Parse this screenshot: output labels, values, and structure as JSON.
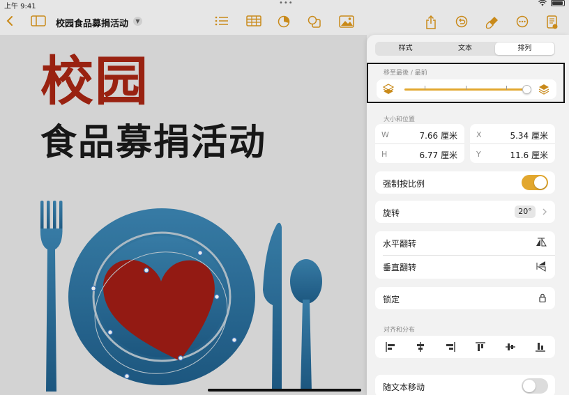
{
  "status": {
    "time": "上午 9:41",
    "center_dots": "•••"
  },
  "toolbar": {
    "title": "校园食品募捐活动",
    "icons": [
      "back-chevron-icon",
      "sidebar-icon",
      "list-icon",
      "table-icon",
      "chart-icon",
      "shape-icon",
      "media-icon",
      "share-icon",
      "undo-icon",
      "format-brush-icon",
      "more-icon",
      "document-icon"
    ],
    "accent": "#c98a1a"
  },
  "canvas": {
    "headline1": "校园",
    "headline2": "食品募捐活动",
    "colors": {
      "headline1": "#a62513",
      "plate": "#2f79a8",
      "heart": "#a01d15"
    }
  },
  "panel": {
    "tabs": [
      {
        "label": "样式",
        "active": false
      },
      {
        "label": "文本",
        "active": false
      },
      {
        "label": "排列",
        "active": true
      }
    ],
    "layer": {
      "label": "移至最後 / 最前",
      "value": 1.0
    },
    "size_position": {
      "label": "大小和位置",
      "w_label": "W",
      "w_value": "7.66 厘米",
      "x_label": "X",
      "x_value": "5.34 厘米",
      "h_label": "H",
      "h_value": "6.77 厘米",
      "y_label": "Y",
      "y_value": "11.6 厘米"
    },
    "constrain": {
      "label": "强制按比例",
      "on": true
    },
    "rotate": {
      "label": "旋转",
      "value": "20°"
    },
    "flip_h": {
      "label": "水平翻转"
    },
    "flip_v": {
      "label": "垂直翻转"
    },
    "lock": {
      "label": "锁定"
    },
    "align": {
      "label": "对齐和分布"
    },
    "move_with_text": {
      "label": "随文本移动",
      "on": false
    }
  }
}
